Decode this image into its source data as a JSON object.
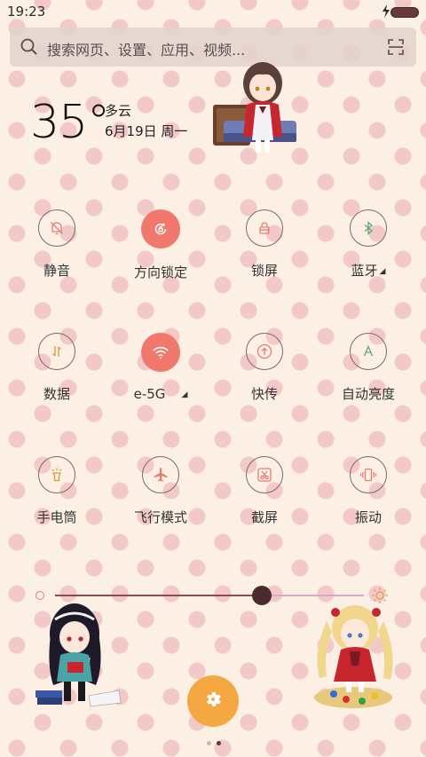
{
  "status_bar": {
    "time": "19:23",
    "icons": [
      "charge-icon",
      "battery-icon"
    ]
  },
  "search": {
    "placeholder": "搜索网页、设置、应用、视频...",
    "icons": [
      "search-icon",
      "scan-icon"
    ]
  },
  "weather": {
    "temperature": "35°",
    "condition": "多云",
    "date": "6月19日 周一"
  },
  "toggles": [
    {
      "label": "静音",
      "icon": "bell-off-icon",
      "active": false
    },
    {
      "label": "方向锁定",
      "icon": "rotation-lock-icon",
      "active": true
    },
    {
      "label": "锁屏",
      "icon": "lock-icon",
      "active": false
    },
    {
      "label": "蓝牙",
      "icon": "bluetooth-icon",
      "active": false,
      "has_menu": true
    },
    {
      "label": "数据",
      "icon": "data-arrows-icon",
      "active": false
    },
    {
      "label": "e-5G",
      "icon": "wifi-icon",
      "active": true,
      "has_menu": true
    },
    {
      "label": "快传",
      "icon": "upload-icon",
      "active": false
    },
    {
      "label": "自动亮度",
      "icon": "auto-brightness-icon",
      "active": false
    },
    {
      "label": "手电筒",
      "icon": "flashlight-icon",
      "active": false
    },
    {
      "label": "飞行模式",
      "icon": "airplane-icon",
      "active": false
    },
    {
      "label": "截屏",
      "icon": "screenshot-icon",
      "active": false
    },
    {
      "label": "振动",
      "icon": "vibrate-icon",
      "active": false
    }
  ],
  "brightness": {
    "level_percent": 67
  },
  "pager": {
    "pages": 2,
    "current": 2
  },
  "colors": {
    "accent_active": "#f0786c",
    "fab": "#f5a842",
    "background": "#fcf0e4",
    "dots": "#f3c8c9"
  }
}
